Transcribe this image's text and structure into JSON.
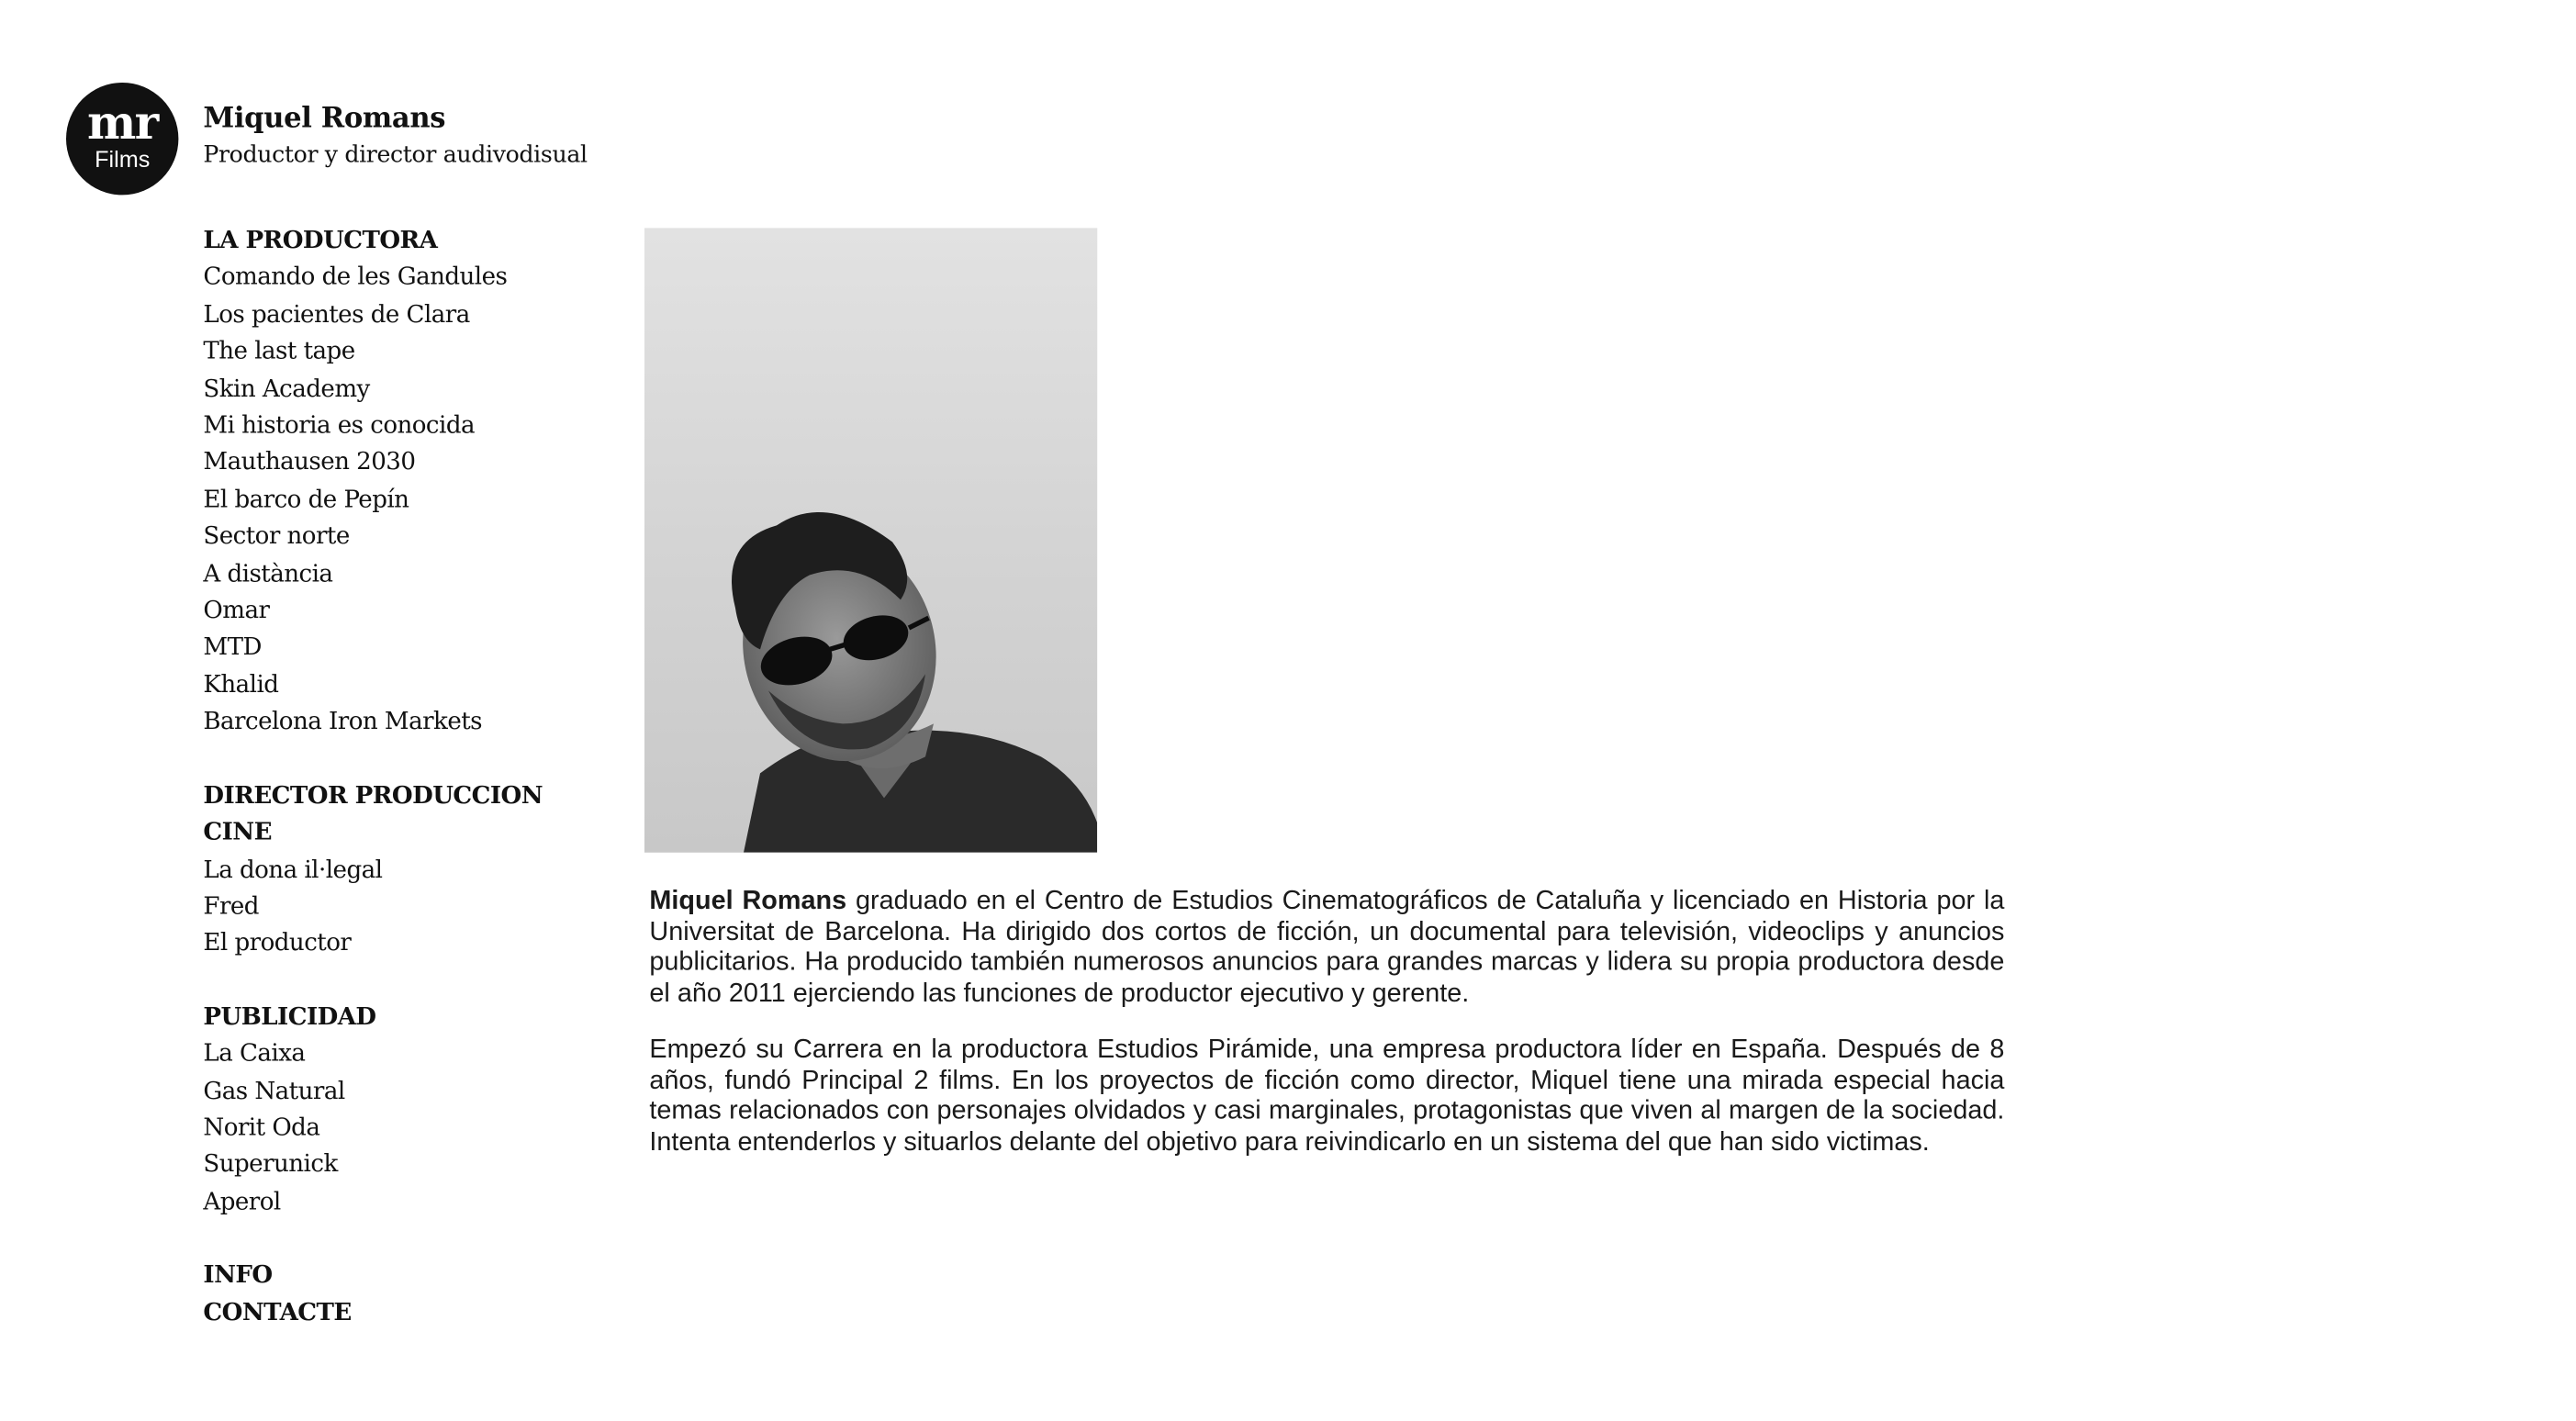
{
  "logo": {
    "mark": "mr",
    "sub": "Films"
  },
  "brand": {
    "name": "Miquel Romans",
    "tagline": "Productor y director audivodisual"
  },
  "nav": {
    "sections": [
      {
        "heading": "LA PRODUCTORA",
        "items": [
          "Comando de les Gandules",
          "Los pacientes de Clara",
          "The last tape",
          "Skin Academy",
          "Mi historia es conocida",
          "Mauthausen 2030",
          "El barco de Pepín",
          "Sector norte",
          "A distància",
          "Omar",
          "MTD",
          "Khalid",
          "Barcelona Iron Markets"
        ]
      },
      {
        "heading": "DIRECTOR PRODUCCION CINE",
        "items": [
          "La dona il·legal",
          "Fred",
          "El productor"
        ]
      },
      {
        "heading": "PUBLICIDAD",
        "items": [
          "La Caixa",
          "Gas Natural",
          "Norit Oda",
          "Superunick",
          "Aperol"
        ]
      }
    ],
    "bottom": {
      "info": "INFO",
      "contact": "CONTACTE"
    }
  },
  "bio": {
    "p1_name": "Miquel Romans",
    "p1_text": " graduado en el Centro de Estudios Cinematográficos de Cataluña y licenciado en Historia por la Universitat de Barcelona. Ha dirigido dos cortos de ficción, un documental para televisión, videoclips y anuncios publicitarios. Ha producido también numerosos anuncios para grandes marcas y lidera su propia productora desde el año 2011 ejerciendo las funciones de productor ejecutivo y gerente.",
    "p2_text": "Empezó su Carrera en la productora Estudios Pirámide, una empresa productora líder en España. Después de 8 años, fundó Principal 2 films. En los proyectos de ficción como director, Miquel tiene una mirada especial hacia temas relacionados con personajes olvidados y casi marginales, protagonistas que viven al margen de la sociedad. Intenta entenderlos y situarlos delante del objetivo para reivindicarlo en un sistema del que han sido victimas."
  },
  "colors": {
    "text": "#111111",
    "background": "#ffffff",
    "logo_bg": "#111111"
  }
}
